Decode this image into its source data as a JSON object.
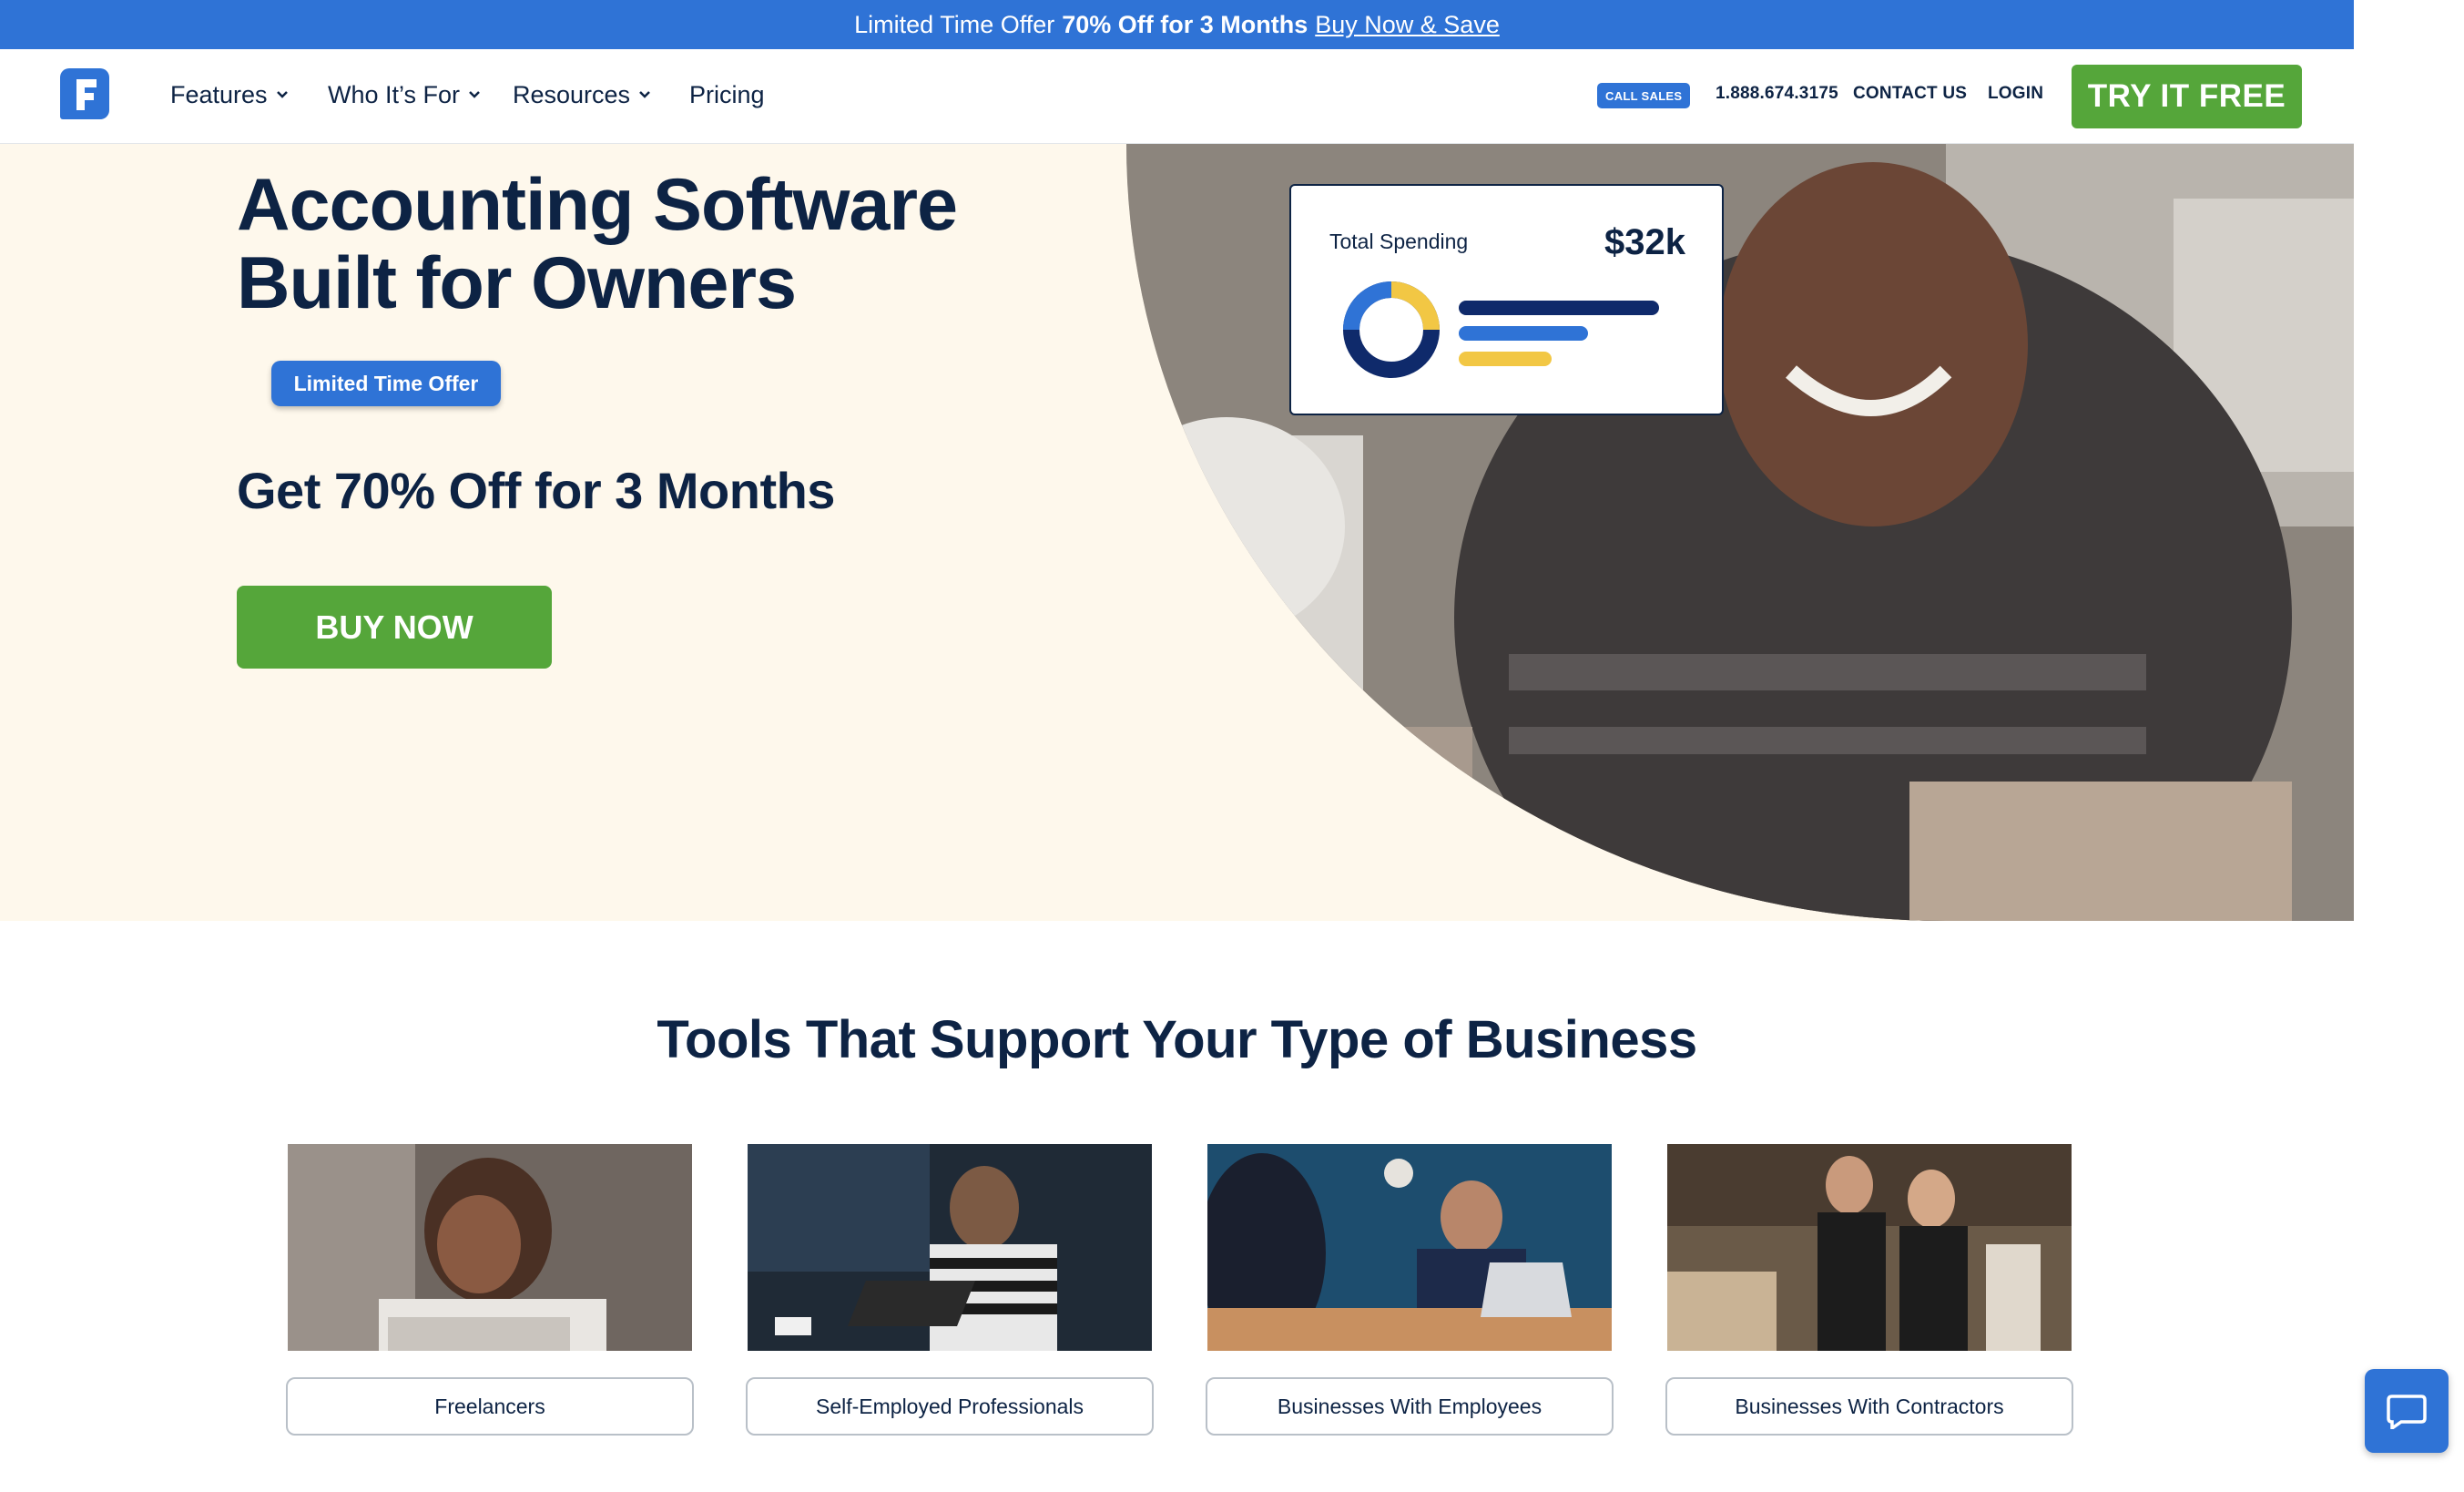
{
  "promo": {
    "lead": "Limited Time Offer",
    "bold": "70% Off for 3 Months",
    "link": "Buy Now & Save"
  },
  "nav": {
    "items": [
      {
        "label": "Features",
        "dropdown": true
      },
      {
        "label": "Who It’s For",
        "dropdown": true
      },
      {
        "label": "Resources",
        "dropdown": true
      },
      {
        "label": "Pricing",
        "dropdown": false
      }
    ],
    "call_sales": "CALL SALES",
    "phone": "1.888.674.3175",
    "contact": "CONTACT US",
    "login": "LOGIN",
    "cta": "TRY IT FREE"
  },
  "hero": {
    "title": "Accounting Software\nBuilt for Owners",
    "pill": "Limited Time Offer",
    "subtitle": "Get 70% Off for 3 Months",
    "button": "BUY NOW",
    "card": {
      "label": "Total Spending",
      "value": "$32k"
    }
  },
  "tools": {
    "title": "Tools That Support Your Type of Business",
    "cards": [
      {
        "label": "Freelancers"
      },
      {
        "label": "Self-Employed Professionals"
      },
      {
        "label": "Businesses With Employees"
      },
      {
        "label": "Businesses With Contractors"
      }
    ]
  },
  "colors": {
    "brand_blue": "#2f73d6",
    "navy": "#0d2344",
    "green": "#55a63a",
    "cream": "#fef8ec",
    "yellow": "#f2c744"
  }
}
